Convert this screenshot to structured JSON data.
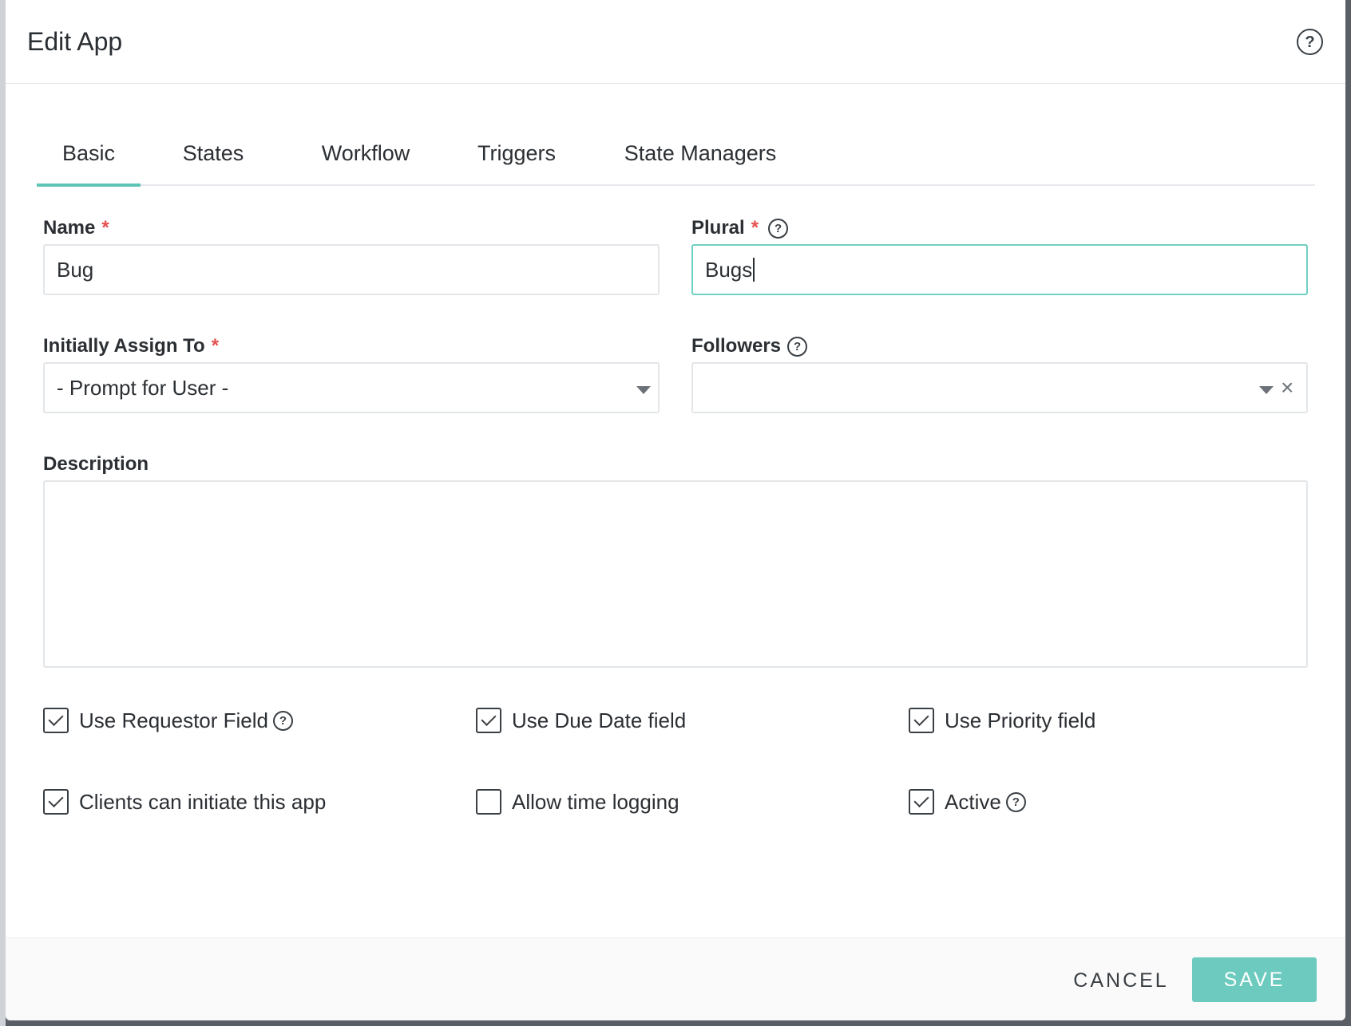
{
  "dialog": {
    "title": "Edit App",
    "help_icon": "question-circle-icon"
  },
  "tabs": [
    {
      "label": "Basic",
      "active": true
    },
    {
      "label": "States",
      "active": false
    },
    {
      "label": "Workflow",
      "active": false
    },
    {
      "label": "Triggers",
      "active": false
    },
    {
      "label": "State Managers",
      "active": false
    }
  ],
  "form": {
    "name": {
      "label": "Name",
      "required_mark": "*",
      "value": "Bug"
    },
    "plural": {
      "label": "Plural",
      "required_mark": "*",
      "value": "Bugs"
    },
    "assign": {
      "label": "Initially Assign To",
      "required_mark": "*",
      "value": "- Prompt for User -"
    },
    "followers": {
      "label": "Followers",
      "value": ""
    },
    "description": {
      "label": "Description",
      "value": ""
    }
  },
  "checkboxes": [
    {
      "label": "Use Requestor Field",
      "checked": true,
      "help": true
    },
    {
      "label": "Use Due Date field",
      "checked": true,
      "help": false
    },
    {
      "label": "Use Priority field",
      "checked": true,
      "help": false
    },
    {
      "label": "Clients can initiate this app",
      "checked": true,
      "help": false
    },
    {
      "label": "Allow time logging",
      "checked": false,
      "help": false
    },
    {
      "label": "Active",
      "checked": true,
      "help": true
    }
  ],
  "footer": {
    "cancel_label": "CANCEL",
    "save_label": "SAVE"
  },
  "colors": {
    "accent": "#5ec4b6",
    "save_button": "#6ccbbe",
    "required": "#e5504f",
    "focus_border": "#6fd0c3"
  }
}
